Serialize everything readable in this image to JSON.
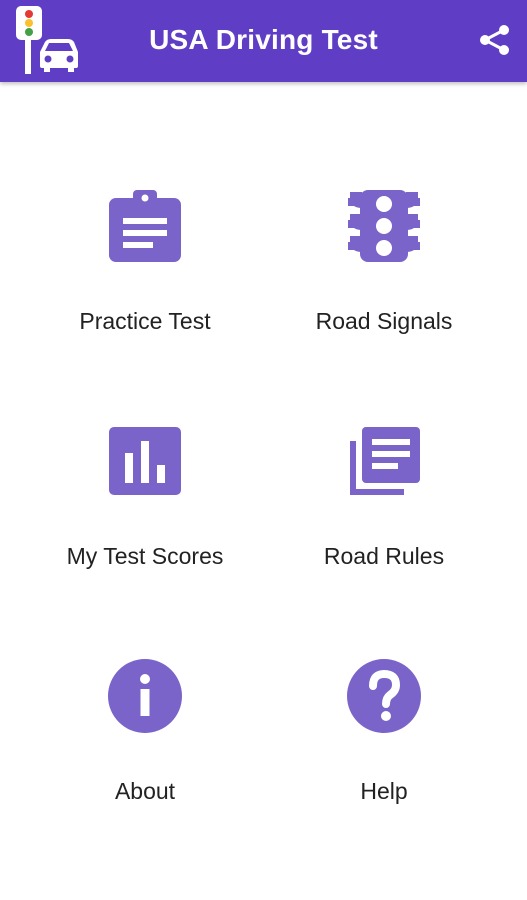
{
  "header": {
    "title": "USA Driving Test",
    "background": "#5f3dc4",
    "logo_icon": "traffic-light-car-icon",
    "share_icon": "share-icon"
  },
  "accent_color": "#7a63c9",
  "menu": [
    {
      "label": "Practice Test",
      "icon": "clipboard-icon"
    },
    {
      "label": "Road Signals",
      "icon": "traffic-light-icon"
    },
    {
      "label": "My Test Scores",
      "icon": "bar-chart-icon"
    },
    {
      "label": "Road Rules",
      "icon": "library-books-icon"
    },
    {
      "label": "About",
      "icon": "info-icon"
    },
    {
      "label": "Help",
      "icon": "help-icon"
    }
  ]
}
